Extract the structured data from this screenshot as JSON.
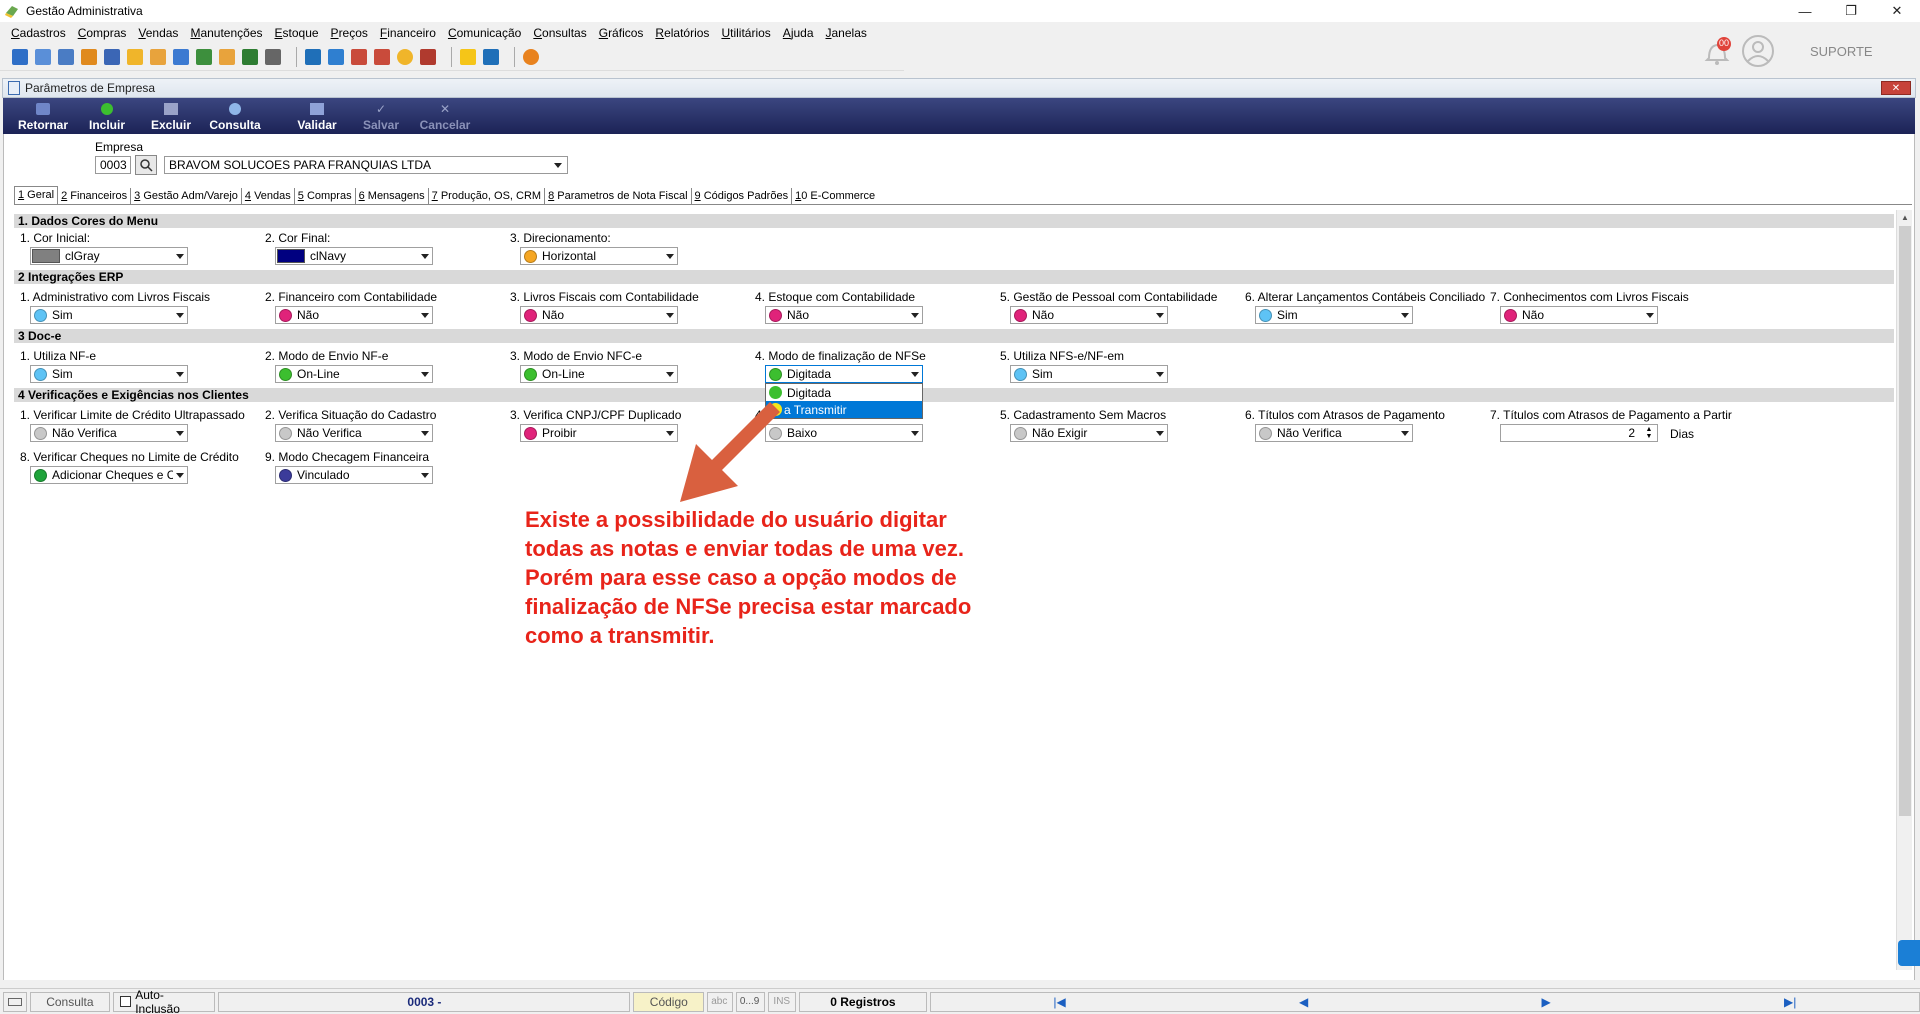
{
  "app": {
    "title": "Gestão Administrativa"
  },
  "menu": [
    "Cadastros",
    "Compras",
    "Vendas",
    "Manutenções",
    "Estoque",
    "Preços",
    "Financeiro",
    "Comunicação",
    "Consultas",
    "Gráficos",
    "Relatórios",
    "Utilitários",
    "Ajuda",
    "Janelas"
  ],
  "user": {
    "name": "SUPORTE",
    "notifications": "00"
  },
  "child": {
    "title": "Parâmetros de Empresa"
  },
  "actions": [
    {
      "label": "Retornar",
      "enabled": true
    },
    {
      "label": "Incluir",
      "enabled": true
    },
    {
      "label": "Excluir",
      "enabled": true
    },
    {
      "label": "Consulta",
      "enabled": true
    },
    {
      "label": "Validar",
      "enabled": true
    },
    {
      "label": "Salvar",
      "enabled": false
    },
    {
      "label": "Cancelar",
      "enabled": false
    }
  ],
  "empresa": {
    "label": "Empresa",
    "code": "0003",
    "name": "BRAVOM SOLUCOES PARA FRANQUIAS LTDA"
  },
  "tabs": [
    "1 Geral",
    "2 Financeiros",
    "3 Gestão Adm/Varejo",
    "4 Vendas",
    "5 Compras",
    "6 Mensagens",
    "7 Produção, OS, CRM",
    "8 Parametros de Nota Fiscal",
    "9 Códigos Padrões",
    "10 E-Commerce"
  ],
  "sections": {
    "s1": "1.  Dados Cores do Menu",
    "s2": "2 Integrações ERP",
    "s3": "3  Doc-e",
    "s4": "4 Verificações e Exigências nos Clientes"
  },
  "fields": {
    "cor_inicial": {
      "label": "1. Cor Inicial:",
      "value": "clGray",
      "swatch": "#808080"
    },
    "cor_final": {
      "label": "2. Cor Final:",
      "value": "clNavy",
      "swatch": "#000080"
    },
    "direcionamento": {
      "label": "3. Direcionamento:",
      "value": "Horizontal",
      "color": "#f5a623"
    },
    "adm_livros": {
      "label": "1. Administrativo com Livros Fiscais",
      "value": "Sim",
      "color": "#5ec3f5"
    },
    "fin_contab": {
      "label": "2. Financeiro com Contabilidade",
      "value": "Não",
      "color": "#e0237a"
    },
    "livros_contab": {
      "label": "3. Livros Fiscais com Contabilidade",
      "value": "Não",
      "color": "#e0237a"
    },
    "estoque_contab": {
      "label": "4. Estoque com Contabilidade",
      "value": "Não",
      "color": "#e0237a"
    },
    "pessoal_contab": {
      "label": "5. Gestão de Pessoal com Contabilidade",
      "value": "Não",
      "color": "#e0237a"
    },
    "alterar_lanc": {
      "label": "6. Alterar Lançamentos Contábeis Conciliado",
      "value": "Sim",
      "color": "#5ec3f5"
    },
    "conhecimentos": {
      "label": "7. Conhecimentos com Livros Fiscais",
      "value": "Não",
      "color": "#e0237a"
    },
    "utiliza_nfe": {
      "label": "1. Utiliza NF-e",
      "value": "Sim",
      "color": "#5ec3f5"
    },
    "envio_nfe": {
      "label": "2. Modo de Envio NF-e",
      "value": "On-Line",
      "color": "#3cbf2f"
    },
    "envio_nfce": {
      "label": "3. Modo de Envio NFC-e",
      "value": "On-Line",
      "color": "#3cbf2f"
    },
    "final_nfse": {
      "label": "4. Modo de finalização de NFSe",
      "value": "Digitada",
      "color": "#3cbf2f"
    },
    "utiliza_nfse": {
      "label": "5. Utiliza NFS-e/NF-em",
      "value": "Sim",
      "color": "#5ec3f5"
    },
    "limite_credito": {
      "label": "1. Verificar Limite de Crédito Ultrapassado",
      "value": "Não Verifica",
      "color": "#c8c8c8"
    },
    "situacao_cad": {
      "label": "2. Verifica Situação do Cadastro",
      "value": "Não Verifica",
      "color": "#c8c8c8"
    },
    "cnpj_dup": {
      "label": "3. Verifica CNPJ/CPF Duplicado",
      "value": "Proibir",
      "color": "#e0237a"
    },
    "field4_4": {
      "label": "4.",
      "value": "Baixo",
      "color": "#c8c8c8"
    },
    "cad_macros": {
      "label": "5. Cadastramento Sem Macros",
      "value": "Não Exigir",
      "color": "#c8c8c8"
    },
    "titulos_atraso": {
      "label": "6. Títulos com Atrasos de Pagamento",
      "value": "Não Verifica",
      "color": "#c8c8c8"
    },
    "titulos_partir": {
      "label": "7. Títulos com Atrasos de Pagamento a Partir",
      "value": "2",
      "unit": "Dias"
    },
    "cheques_limite": {
      "label": "8. Verificar Cheques no Limite de Crédito",
      "value": "Adicionar Cheques e C",
      "color": "#1ea33a"
    },
    "checagem_fin": {
      "label": "9. Modo Checagem Financeira",
      "value": "Vinculado",
      "color": "#3b3b9a"
    }
  },
  "dropdown": [
    {
      "label": "Digitada",
      "color": "#3cbf2f",
      "selected": false
    },
    {
      "label": "a Transmitir",
      "color": "#f5e61b",
      "selected": true
    }
  ],
  "annotation": [
    "Existe a possibilidade do usuário digitar",
    "todas as notas e enviar todas de uma vez.",
    "Porém para esse caso a opção modos de",
    "finalização de NFSe precisa estar marcado",
    "como a transmitir."
  ],
  "status": {
    "mode": "Consulta",
    "auto": "Auto-Inclusão",
    "record": "0003 -",
    "codigo": "Código",
    "abc": "abc",
    "range": "0...9",
    "ins": "INS",
    "registros": "0 Registros"
  }
}
